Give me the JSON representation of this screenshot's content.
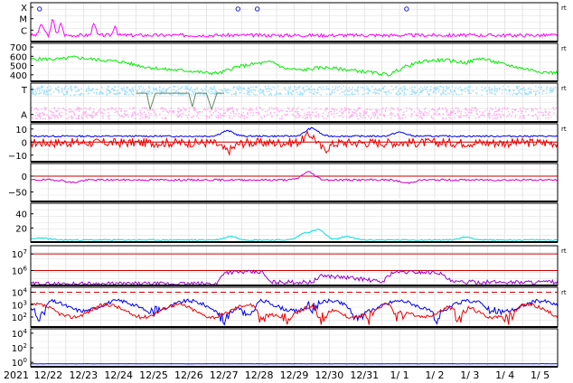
{
  "chart_data": {
    "type": "line",
    "title": "",
    "year_label": "2021",
    "x_ticks": [
      "12/22",
      "12/23",
      "12/24",
      "12/25",
      "12/26",
      "12/27",
      "12/28",
      "12/29",
      "12/30",
      "12/31",
      "1/ 1",
      "1/ 2",
      "1/ 3",
      "1/ 4",
      "1/ 5"
    ],
    "grid": true,
    "panels": [
      {
        "id": "xray",
        "yticks": [
          {
            "label": "X",
            "v": 3
          },
          {
            "label": "M",
            "v": 2
          },
          {
            "label": "C",
            "v": 1
          }
        ],
        "ylim": [
          0,
          3.4
        ],
        "side_label": "rt",
        "series": [
          {
            "color": "#ff00ff",
            "mode": "line",
            "base": 0.55,
            "amp": 0.25,
            "spikes": [
              [
                0.28,
                0.9
              ],
              [
                0.38,
                0.5
              ],
              [
                0.62,
                1.0
              ],
              [
                0.66,
                0.6
              ],
              [
                0.86,
                1.1
              ],
              [
                1.8,
                1.2
              ],
              [
                2.4,
                0.9
              ]
            ],
            "seed": 3
          }
        ],
        "markers": [
          {
            "x": 0.25,
            "y": 2.85
          },
          {
            "x": 5.9,
            "y": 2.85
          },
          {
            "x": 6.45,
            "y": 2.85
          },
          {
            "x": 10.7,
            "y": 2.85
          }
        ]
      },
      {
        "id": "wind_speed",
        "yticks": [
          {
            "label": "700",
            "v": 700
          },
          {
            "label": "600",
            "v": 600
          },
          {
            "label": "500",
            "v": 500
          },
          {
            "label": "400",
            "v": 400
          }
        ],
        "ylim": [
          330,
          740
        ],
        "side_label": "rt",
        "series": [
          {
            "color": "#00ee00",
            "mode": "segments",
            "points": [
              [
                0.1,
                570
              ],
              [
                0.9,
                570
              ],
              [
                1.2,
                590
              ],
              [
                2.0,
                560
              ],
              [
                2.6,
                540
              ],
              [
                3.2,
                490
              ],
              [
                3.8,
                460
              ],
              [
                4.6,
                440
              ],
              [
                5.0,
                420
              ],
              [
                5.4,
                420
              ],
              [
                5.8,
                480
              ],
              [
                6.4,
                520
              ],
              [
                6.9,
                540
              ],
              [
                7.2,
                470
              ],
              [
                7.7,
                450
              ],
              [
                8.3,
                480
              ],
              [
                8.9,
                460
              ],
              [
                9.6,
                430
              ],
              [
                10.2,
                400
              ],
              [
                10.6,
                480
              ],
              [
                11.2,
                550
              ],
              [
                11.8,
                560
              ],
              [
                12.4,
                530
              ],
              [
                12.8,
                580
              ],
              [
                13.4,
                520
              ],
              [
                14.0,
                470
              ],
              [
                14.6,
                430
              ],
              [
                15.0,
                420
              ]
            ],
            "noise": 18,
            "seed": 5
          }
        ]
      },
      {
        "id": "imf_angle",
        "yticks": [
          {
            "label": "T",
            "v": 1
          },
          {
            "label": "A",
            "v": -1
          }
        ],
        "ylim": [
          -1.6,
          1.5
        ],
        "side_label": "rt",
        "series": [
          {
            "color": "#99ddff",
            "mode": "scatter",
            "band": [
              0.6,
              1.3
            ],
            "seed": 7
          },
          {
            "color": "#ffaaee",
            "mode": "scatter",
            "band": [
              -1.3,
              -0.4
            ],
            "seed": 11
          }
        ],
        "trace": [
          [
            3.0,
            0.7
          ],
          [
            3.3,
            0.7
          ],
          [
            3.4,
            -0.6
          ],
          [
            3.55,
            0.7
          ],
          [
            4.5,
            0.7
          ],
          [
            4.6,
            -0.4
          ],
          [
            4.7,
            0.7
          ],
          [
            5.0,
            0.7
          ],
          [
            5.15,
            -0.6
          ],
          [
            5.3,
            0.7
          ],
          [
            5.5,
            0.7
          ]
        ]
      },
      {
        "id": "bz_bt",
        "yticks": [
          {
            "label": "10",
            "v": 10
          },
          {
            "label": "0",
            "v": 0
          },
          {
            "label": "−10",
            "v": -10
          }
        ],
        "ylim": [
          -15,
          14
        ],
        "side_label": "rt",
        "series": [
          {
            "color": "#0000ee",
            "mode": "line",
            "base": 4.5,
            "amp": 1.0,
            "bumps": [
              [
                5.6,
                4
              ],
              [
                8.0,
                6
              ],
              [
                10.5,
                3
              ]
            ],
            "seed": 13
          },
          {
            "color": "#ee0000",
            "mode": "noisy",
            "base": -0.5,
            "amp": 3.5,
            "bumps": [
              [
                5.6,
                -6
              ],
              [
                8.0,
                7
              ],
              [
                8.3,
                -6
              ]
            ],
            "seed": 17
          }
        ],
        "hline": {
          "v": 0,
          "color": "#cc0000"
        }
      },
      {
        "id": "phi",
        "yticks": [
          {
            "label": "0",
            "v": 0
          },
          {
            "label": "−50",
            "v": -50
          }
        ],
        "ylim": [
          -80,
          40
        ],
        "side_label": "",
        "series": [
          {
            "color": "#cc00cc",
            "mode": "line",
            "base": -12,
            "amp": 5,
            "bumps": [
              [
                7.9,
                25
              ],
              [
                1.2,
                -8
              ],
              [
                10.7,
                -10
              ]
            ],
            "seed": 19
          }
        ],
        "hline": {
          "v": 0,
          "color": "#cc0000"
        }
      },
      {
        "id": "density",
        "yticks": [
          {
            "label": "40",
            "v": 40
          },
          {
            "label": "20",
            "v": 20
          }
        ],
        "ylim": [
          0,
          55
        ],
        "side_label": "",
        "series": [
          {
            "color": "#00dddd",
            "mode": "line",
            "base": 3,
            "amp": 1.5,
            "bumps": [
              [
                0.3,
                3
              ],
              [
                5.7,
                5
              ],
              [
                7.8,
                9
              ],
              [
                8.2,
                14
              ],
              [
                9.0,
                5
              ],
              [
                12.4,
                4
              ]
            ],
            "seed": 23
          }
        ]
      },
      {
        "id": "electrons",
        "yticks": [
          {
            "label": "10^7",
            "v": 7
          },
          {
            "label": "10^6",
            "v": 6
          }
        ],
        "ylim": [
          5.1,
          7.5
        ],
        "side_label": "rt",
        "series": [
          {
            "color": "#9900cc",
            "mode": "segments",
            "points": [
              [
                0.0,
                5.2
              ],
              [
                5.3,
                5.2
              ],
              [
                5.5,
                5.9
              ],
              [
                6.6,
                5.9
              ],
              [
                6.8,
                5.3
              ],
              [
                8.0,
                5.3
              ],
              [
                8.3,
                5.7
              ],
              [
                9.4,
                5.5
              ],
              [
                10.0,
                5.3
              ],
              [
                10.3,
                5.9
              ],
              [
                11.6,
                5.9
              ],
              [
                12.0,
                5.3
              ],
              [
                15.0,
                5.3
              ]
            ],
            "noise": 0.12,
            "seed": 29
          }
        ],
        "hlines": [
          {
            "v": 7,
            "color": "#cc0000"
          },
          {
            "v": 6,
            "color": "#cc0000"
          }
        ]
      },
      {
        "id": "protons",
        "yticks": [
          {
            "label": "10^4",
            "v": 4
          },
          {
            "label": "10^3",
            "v": 3
          },
          {
            "label": "10^2",
            "v": 2
          }
        ],
        "ylim": [
          1.2,
          4.4
        ],
        "side_label": "rt",
        "series": [
          {
            "color": "#0000ee",
            "mode": "wave",
            "base": 2.9,
            "amp": 0.4,
            "dips": [
              [
                0.25,
                1.3
              ],
              [
                3.5,
                2.0
              ],
              [
                5.5,
                1.3
              ],
              [
                6.2,
                1.3
              ],
              [
                8.0,
                2.2
              ],
              [
                9.3,
                1.3
              ],
              [
                11.6,
                1.3
              ],
              [
                13.2,
                1.6
              ]
            ],
            "seed": 31
          },
          {
            "color": "#ee0000",
            "mode": "wave",
            "base": 2.5,
            "amp": 0.5,
            "dips": [
              [
                6.6,
                1.3
              ],
              [
                7.3,
                1.3
              ],
              [
                8.3,
                1.3
              ],
              [
                9.6,
                1.3
              ],
              [
                10.5,
                1.3
              ],
              [
                12.2,
                1.3
              ],
              [
                13.6,
                1.3
              ]
            ],
            "seed": 37
          }
        ],
        "hline": {
          "v": 4,
          "color": "#cc0000",
          "dash": true
        }
      },
      {
        "id": "high_energy",
        "yticks": [
          {
            "label": "10^4",
            "v": 4
          },
          {
            "label": "10^2",
            "v": 2
          },
          {
            "label": "10^0",
            "v": 0
          }
        ],
        "ylim": [
          -0.6,
          4.6
        ],
        "side_label": "",
        "series": [
          {
            "color": "#0000ee",
            "mode": "line",
            "base": -0.2,
            "amp": 0.03,
            "bumps": [],
            "seed": 41
          }
        ]
      }
    ]
  }
}
